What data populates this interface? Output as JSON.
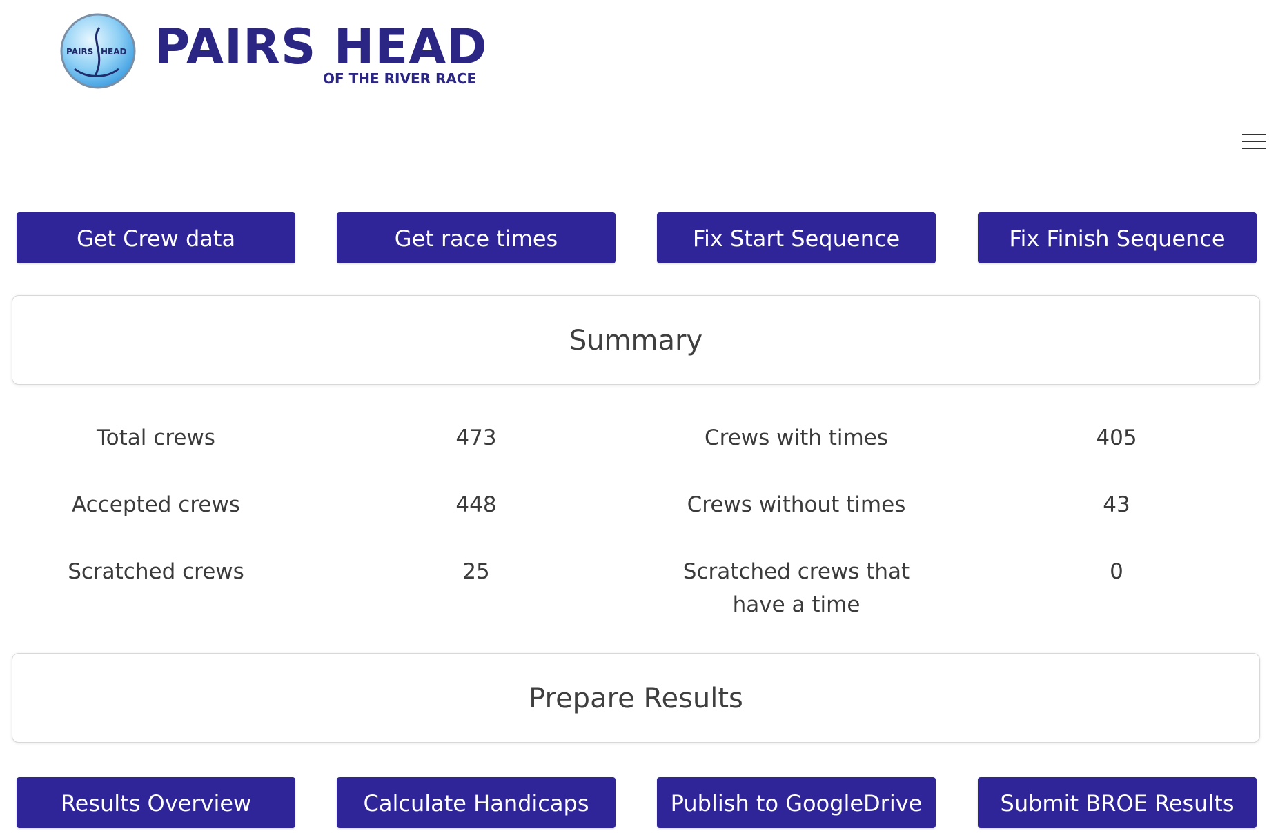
{
  "header": {
    "logo": {
      "badge_left": "PAIRS",
      "badge_right": "HEAD",
      "title": "PAIRS HEAD",
      "subtitle": "OF THE RIVER RACE"
    },
    "menu_icon": "hamburger-menu-icon"
  },
  "top_buttons": [
    {
      "label": "Get Crew data"
    },
    {
      "label": "Get race times"
    },
    {
      "label": "Fix Start Sequence"
    },
    {
      "label": "Fix Finish Sequence"
    }
  ],
  "summary": {
    "heading": "Summary",
    "rows": [
      {
        "left_label": "Total crews",
        "left_value": "473",
        "right_label": "Crews with times",
        "right_value": "405"
      },
      {
        "left_label": "Accepted crews",
        "left_value": "448",
        "right_label": "Crews without times",
        "right_value": "43"
      },
      {
        "left_label": "Scratched crews",
        "left_value": "25",
        "right_label": "Scratched crews that have a time",
        "right_value": "0"
      }
    ]
  },
  "prepare": {
    "heading": "Prepare Results"
  },
  "bottom_buttons": [
    {
      "label": "Results Overview"
    },
    {
      "label": "Calculate Handicaps"
    },
    {
      "label": "Publish to GoogleDrive"
    },
    {
      "label": "Submit BROE Results"
    }
  ],
  "colors": {
    "brand": "#2b2583",
    "button": "#2f2598",
    "button_text": "#ffffff"
  }
}
